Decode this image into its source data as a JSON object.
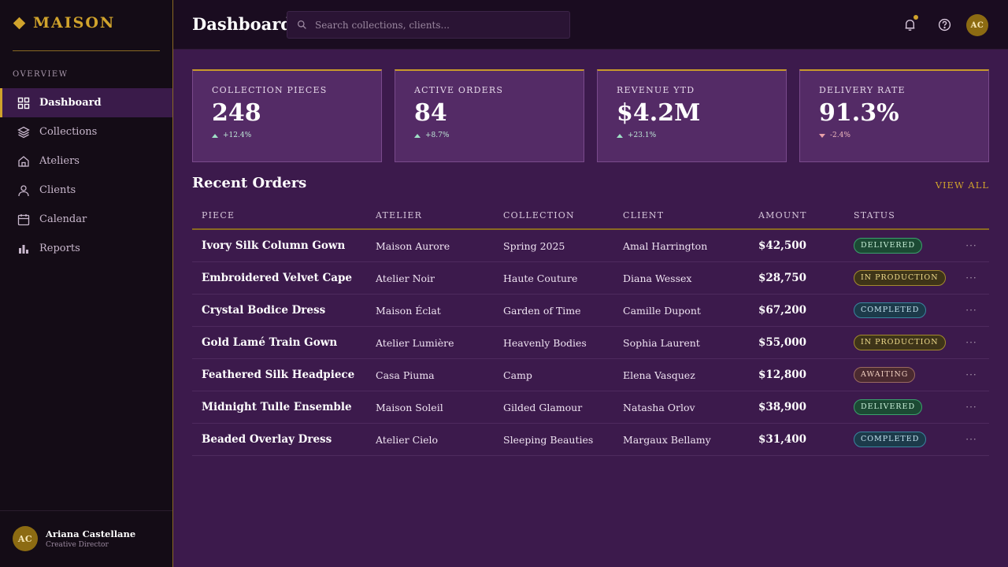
{
  "brand": {
    "name": "MAISON"
  },
  "sidebar": {
    "section_label": "OVERVIEW",
    "items": [
      {
        "label": "Dashboard",
        "icon": "grid-icon",
        "active": true
      },
      {
        "label": "Collections",
        "icon": "layers-icon",
        "active": false
      },
      {
        "label": "Ateliers",
        "icon": "house-icon",
        "active": false
      },
      {
        "label": "Clients",
        "icon": "user-icon",
        "active": false
      },
      {
        "label": "Calendar",
        "icon": "calendar-icon",
        "active": false
      },
      {
        "label": "Reports",
        "icon": "bar-chart-icon",
        "active": false
      }
    ],
    "user": {
      "initials": "AC",
      "name": "Ariana Castellane",
      "role": "Creative Director"
    }
  },
  "header": {
    "title": "Dashboard",
    "search_placeholder": "Search collections, clients...",
    "avatar_initials": "AC"
  },
  "kpis": [
    {
      "label": "COLLECTION PIECES",
      "value": "248",
      "delta": "+12.4%",
      "direction": "up"
    },
    {
      "label": "ACTIVE ORDERS",
      "value": "84",
      "delta": "+8.7%",
      "direction": "up"
    },
    {
      "label": "REVENUE YTD",
      "value": "$4.2M",
      "delta": "+23.1%",
      "direction": "up"
    },
    {
      "label": "DELIVERY RATE",
      "value": "91.3%",
      "delta": "-2.4%",
      "direction": "down"
    }
  ],
  "orders": {
    "title": "Recent Orders",
    "view_all": "VIEW ALL",
    "columns": {
      "piece": "PIECE",
      "atelier": "ATELIER",
      "collection": "COLLECTION",
      "client": "CLIENT",
      "amount": "AMOUNT",
      "status": "STATUS"
    },
    "rows": [
      {
        "piece": "Ivory Silk Column Gown",
        "atelier": "Maison Aurore",
        "collection": "Spring 2025",
        "client": "Amal Harrington",
        "amount": "$42,500",
        "status": "DELIVERED",
        "status_kind": "delivered",
        "actions": "···"
      },
      {
        "piece": "Embroidered Velvet Cape",
        "atelier": "Atelier Noir",
        "collection": "Haute Couture",
        "client": "Diana Wessex",
        "amount": "$28,750",
        "status": "IN PRODUCTION",
        "status_kind": "production",
        "actions": "···"
      },
      {
        "piece": "Crystal Bodice Dress",
        "atelier": "Maison Éclat",
        "collection": "Garden of Time",
        "client": "Camille Dupont",
        "amount": "$67,200",
        "status": "COMPLETED",
        "status_kind": "completed",
        "actions": "···"
      },
      {
        "piece": "Gold Lamé Train Gown",
        "atelier": "Atelier Lumière",
        "collection": "Heavenly Bodies",
        "client": "Sophia Laurent",
        "amount": "$55,000",
        "status": "IN PRODUCTION",
        "status_kind": "production",
        "actions": "···"
      },
      {
        "piece": "Feathered Silk Headpiece",
        "atelier": "Casa Piuma",
        "collection": "Camp",
        "client": "Elena Vasquez",
        "amount": "$12,800",
        "status": "AWAITING",
        "status_kind": "awaiting",
        "actions": "···"
      },
      {
        "piece": "Midnight Tulle Ensemble",
        "atelier": "Maison Soleil",
        "collection": "Gilded Glamour",
        "client": "Natasha Orlov",
        "amount": "$38,900",
        "status": "DELIVERED",
        "status_kind": "delivered",
        "actions": "···"
      },
      {
        "piece": "Beaded Overlay Dress",
        "atelier": "Atelier Cielo",
        "collection": "Sleeping Beauties",
        "client": "Margaux Bellamy",
        "amount": "$31,400",
        "status": "COMPLETED",
        "status_kind": "completed",
        "actions": "···"
      }
    ]
  },
  "colors": {
    "accent": "#d0a32c",
    "sidebar_bg": "#140c16",
    "main_bg": "#3c1a4c",
    "card_bg": "#542b66"
  }
}
